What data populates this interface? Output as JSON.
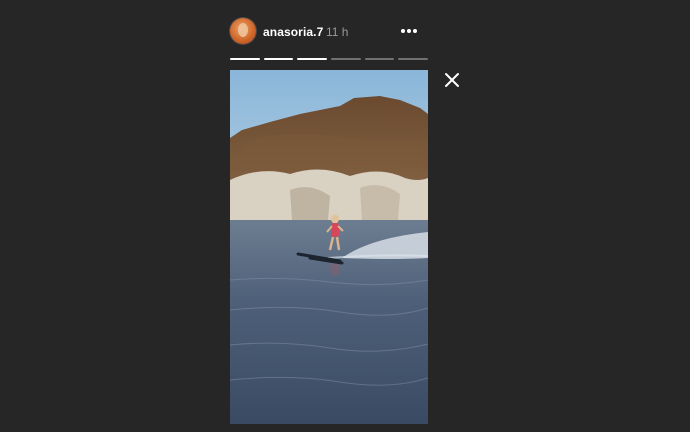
{
  "story": {
    "username": "anasoria.7",
    "timestamp": "11 h"
  },
  "progress": {
    "segments": 6,
    "completed": 3
  },
  "icons": {
    "more": "more-options-icon",
    "close": "close-icon"
  },
  "colors": {
    "background": "#262626",
    "text": "#ffffff",
    "muted": "#9a9a9a"
  }
}
